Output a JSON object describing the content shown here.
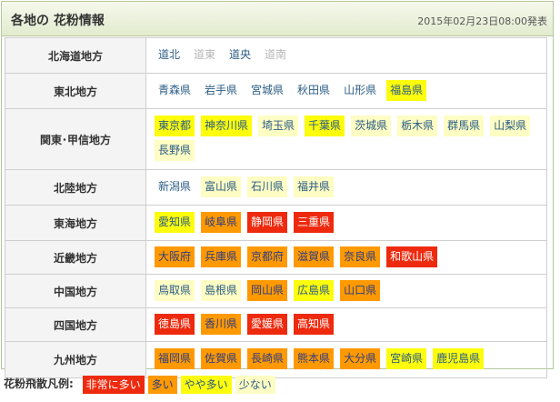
{
  "header": {
    "title": "各地の 花粉情報",
    "date": "2015年02月23日08:00発表"
  },
  "regions": [
    {
      "name": "北海道地方",
      "prefs": [
        {
          "name": "道北",
          "level": "none"
        },
        {
          "name": "道東",
          "level": "nodata"
        },
        {
          "name": "道央",
          "level": "none"
        },
        {
          "name": "道南",
          "level": "nodata"
        }
      ]
    },
    {
      "name": "東北地方",
      "prefs": [
        {
          "name": "青森県",
          "level": "none"
        },
        {
          "name": "岩手県",
          "level": "none"
        },
        {
          "name": "宮城県",
          "level": "none"
        },
        {
          "name": "秋田県",
          "level": "none"
        },
        {
          "name": "山形県",
          "level": "none"
        },
        {
          "name": "福島県",
          "level": "lv2"
        }
      ]
    },
    {
      "name": "関東･甲信地方",
      "prefs": [
        {
          "name": "東京都",
          "level": "lv2"
        },
        {
          "name": "神奈川県",
          "level": "lv2"
        },
        {
          "name": "埼玉県",
          "level": "lv1"
        },
        {
          "name": "千葉県",
          "level": "lv2"
        },
        {
          "name": "茨城県",
          "level": "lv1"
        },
        {
          "name": "栃木県",
          "level": "lv1"
        },
        {
          "name": "群馬県",
          "level": "lv1"
        },
        {
          "name": "山梨県",
          "level": "lv1"
        },
        {
          "name": "長野県",
          "level": "lv1"
        }
      ]
    },
    {
      "name": "北陸地方",
      "prefs": [
        {
          "name": "新潟県",
          "level": "none"
        },
        {
          "name": "富山県",
          "level": "lv1"
        },
        {
          "name": "石川県",
          "level": "lv1"
        },
        {
          "name": "福井県",
          "level": "lv1"
        }
      ]
    },
    {
      "name": "東海地方",
      "prefs": [
        {
          "name": "愛知県",
          "level": "lv2"
        },
        {
          "name": "岐阜県",
          "level": "lv3"
        },
        {
          "name": "静岡県",
          "level": "lv4"
        },
        {
          "name": "三重県",
          "level": "lv4"
        }
      ]
    },
    {
      "name": "近畿地方",
      "prefs": [
        {
          "name": "大阪府",
          "level": "lv3"
        },
        {
          "name": "兵庫県",
          "level": "lv3"
        },
        {
          "name": "京都府",
          "level": "lv3"
        },
        {
          "name": "滋賀県",
          "level": "lv3"
        },
        {
          "name": "奈良県",
          "level": "lv3"
        },
        {
          "name": "和歌山県",
          "level": "lv4"
        }
      ]
    },
    {
      "name": "中国地方",
      "prefs": [
        {
          "name": "鳥取県",
          "level": "lv1"
        },
        {
          "name": "島根県",
          "level": "lv1"
        },
        {
          "name": "岡山県",
          "level": "lv3"
        },
        {
          "name": "広島県",
          "level": "lv2"
        },
        {
          "name": "山口県",
          "level": "lv3"
        }
      ]
    },
    {
      "name": "四国地方",
      "prefs": [
        {
          "name": "徳島県",
          "level": "lv4"
        },
        {
          "name": "香川県",
          "level": "lv3"
        },
        {
          "name": "愛媛県",
          "level": "lv4"
        },
        {
          "name": "高知県",
          "level": "lv4"
        }
      ]
    },
    {
      "name": "九州地方",
      "prefs": [
        {
          "name": "福岡県",
          "level": "lv3"
        },
        {
          "name": "佐賀県",
          "level": "lv3"
        },
        {
          "name": "長崎県",
          "level": "lv3"
        },
        {
          "name": "熊本県",
          "level": "lv3"
        },
        {
          "name": "大分県",
          "level": "lv3"
        },
        {
          "name": "宮崎県",
          "level": "lv2"
        },
        {
          "name": "鹿児島県",
          "level": "lv2"
        }
      ]
    }
  ],
  "legend": {
    "label": "花粉飛散凡例:",
    "items": [
      {
        "text": "非常に多い",
        "level": "lv4"
      },
      {
        "text": "多い",
        "level": "lv3"
      },
      {
        "text": "やや多い",
        "level": "lv2"
      },
      {
        "text": "少ない",
        "level": "lv1"
      }
    ]
  },
  "colors": {
    "very_high": "#ee2a0e",
    "high": "#ff9900",
    "moderate": "#fcfc0c",
    "low": "#fdfdc4",
    "link": "#2b5c86",
    "no_data": "#b7b7b7"
  }
}
